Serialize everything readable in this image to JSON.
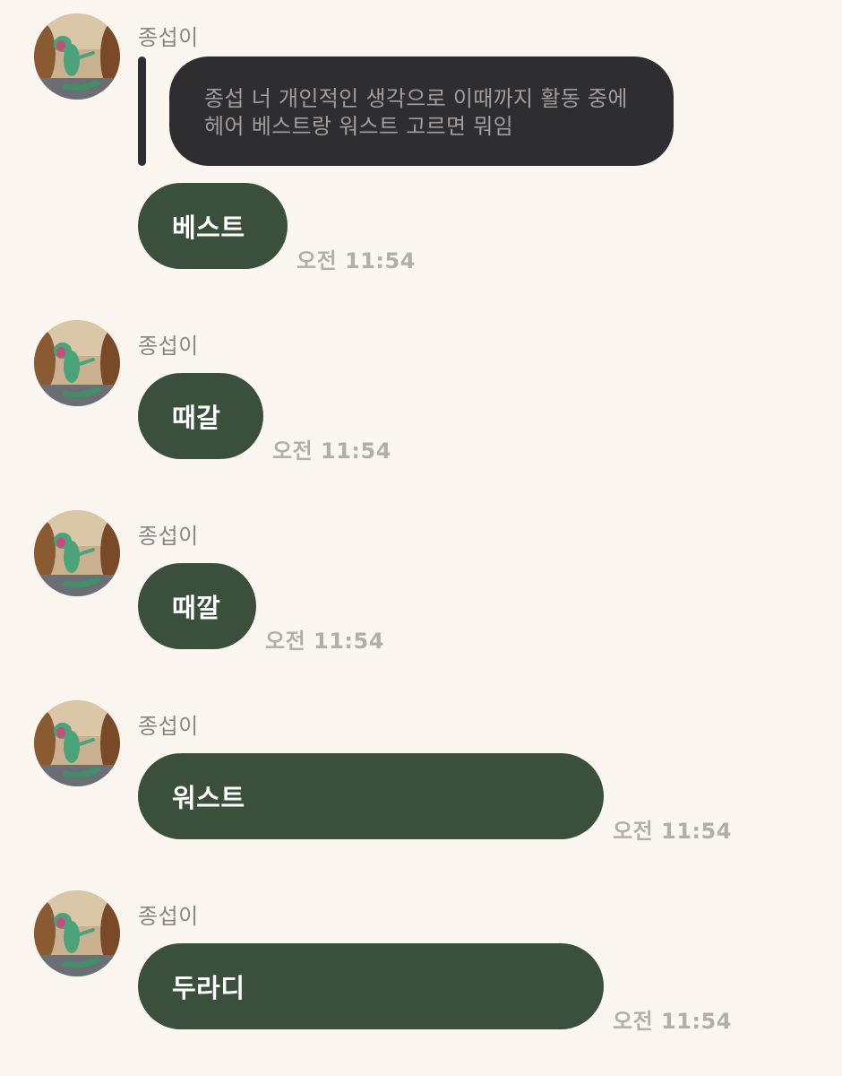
{
  "messages": [
    {
      "sender": "종섭이",
      "quote": {
        "line1": "종섭 너 개인적인 생각으로 이때까지 활동 중에",
        "line2": "헤어 베스트랑 워스트 고르면 뭐임"
      },
      "text": "베스트",
      "time": "오전 11:54"
    },
    {
      "sender": "종섭이",
      "text": "때갈",
      "time": "오전 11:54"
    },
    {
      "sender": "종섭이",
      "text": "때깔",
      "time": "오전 11:54"
    },
    {
      "sender": "종섭이",
      "text": "워스트",
      "time": "오전 11:54"
    },
    {
      "sender": "종섭이",
      "text": "두라디",
      "time": "오전 11:54"
    }
  ],
  "colors": {
    "background": "#fcf6f0",
    "bubble": "#3b503c",
    "quote_bubble": "#2e2e30",
    "sender_text": "#8a8580",
    "time_text": "#b2aeaa"
  },
  "icons": {
    "avatar": "dinosaur-profile-photo"
  }
}
